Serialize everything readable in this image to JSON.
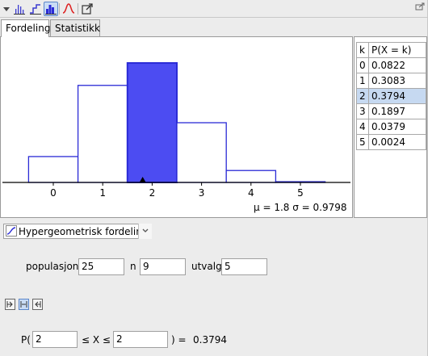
{
  "tabs": [
    {
      "label": "Fordeling",
      "active": true
    },
    {
      "label": "Statistikk",
      "active": false
    }
  ],
  "toolbar": {
    "icons": [
      "menu-triangle-icon",
      "bar-graph-icon",
      "step-graph-icon",
      "overlay-bar-icon",
      "normal-curve-icon",
      "export-icon"
    ],
    "active": "overlay-bar-icon",
    "corner_icon": "undock-icon"
  },
  "chart_data": {
    "type": "bar",
    "categories": [
      "0",
      "1",
      "2",
      "3",
      "4",
      "5"
    ],
    "values": [
      0.0822,
      0.3083,
      0.3794,
      0.1897,
      0.0379,
      0.0024
    ],
    "highlighted": "2",
    "highlight_color": "#4c4cf2",
    "bar_stroke_color": "#2b2bd6",
    "mean_marker_x": 1.8,
    "stats_text": "μ = 1.8   σ = 0.9798",
    "xlabel": "",
    "ylabel": ""
  },
  "table": {
    "headers": [
      "k",
      "P(X = k)"
    ],
    "rows": [
      {
        "k": "0",
        "p": "0.0822"
      },
      {
        "k": "1",
        "p": "0.3083"
      },
      {
        "k": "2",
        "p": "0.3794"
      },
      {
        "k": "3",
        "p": "0.1897"
      },
      {
        "k": "4",
        "p": "0.0379"
      },
      {
        "k": "5",
        "p": "0.0024"
      }
    ],
    "selected_k": "2"
  },
  "distribution": {
    "selected": "Hypergeometrisk fordeling"
  },
  "params": {
    "populasjon_label": "populasjon",
    "populasjon_value": "25",
    "n_label": "n",
    "n_value": "9",
    "utvalg_label": "utvalg",
    "utvalg_value": "5"
  },
  "probability": {
    "prefix": "P(",
    "lower_value": "2",
    "middle": "≤ X ≤",
    "upper_value": "2",
    "suffix": ") =",
    "result": "0.3794"
  },
  "colors": {
    "selected_row": "#c6d9f1",
    "accent": "#2b2bd6"
  }
}
